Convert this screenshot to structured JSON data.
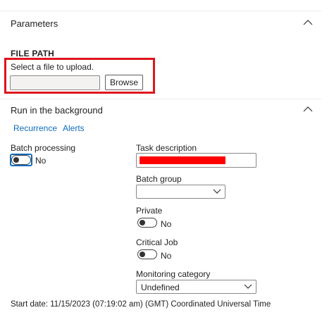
{
  "parameters": {
    "title": "Parameters"
  },
  "file_path": {
    "heading": "FILE PATH",
    "instruction": "Select a file to upload.",
    "input_value": "",
    "browse_label": "Browse"
  },
  "background": {
    "title": "Run in the background",
    "tabs": [
      {
        "label": "Recurrence"
      },
      {
        "label": "Alerts"
      }
    ],
    "batch_processing": {
      "label": "Batch processing",
      "state": "No"
    },
    "task_description": {
      "label": "Task description",
      "value": "",
      "redaction_color": "#ff0000"
    },
    "batch_group": {
      "label": "Batch group",
      "value": ""
    },
    "private": {
      "label": "Private",
      "state": "No"
    },
    "critical_job": {
      "label": "Critical Job",
      "state": "No"
    },
    "monitoring_category": {
      "label": "Monitoring category",
      "value": "Undefined"
    },
    "start_date": "Start date: 11/15/2023 (07:19:02 am) (GMT) Coordinated Universal Time"
  },
  "colors": {
    "highlight": "#e0141e",
    "link": "#0f6cbd"
  },
  "icons": {
    "collapse": "chevron-up-icon",
    "dropdown": "chevron-down-icon"
  }
}
